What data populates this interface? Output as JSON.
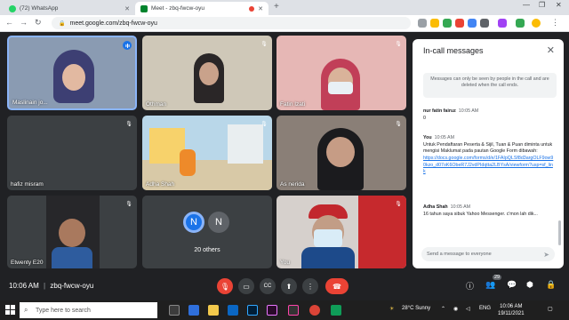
{
  "browser": {
    "tabs": [
      {
        "label": "(72) WhatsApp",
        "color": "#25d366"
      },
      {
        "label": "Meet - zbq-fwcw-oyu",
        "color": "#00832d"
      }
    ],
    "url": "meet.google.com/zbq-fwcw-oyu"
  },
  "tiles": [
    {
      "name": "Maslinain jo...",
      "bg": "#8a9bb2",
      "muted": false
    },
    {
      "name": "Othman",
      "bg": "#cfc8b8",
      "muted": true
    },
    {
      "name": "Fatin Izati",
      "bg": "#e6b7b5",
      "muted": true
    },
    {
      "name": "hafiz misram",
      "bg": "#3c4043",
      "muted": true
    },
    {
      "name": "Adha Shah",
      "bg": "#b9d7e9",
      "muted": true
    },
    {
      "name": "As nerida",
      "bg": "#8a7f77",
      "muted": true
    },
    {
      "name": "Etwenty E20",
      "bg": "#27272a",
      "muted": true
    },
    {
      "name": "20 others",
      "bg": "#3c4043",
      "muted": false
    },
    {
      "name": "You",
      "bg": "#d6d0cc",
      "muted": true
    }
  ],
  "others_avatars": [
    "N",
    "N"
  ],
  "chat": {
    "title": "In-call messages",
    "notice": "Messages can only be seen by people in the call and are deleted when the call ends.",
    "messages": [
      {
        "sender": "nur fatin fairuz",
        "time": "10:05 AM",
        "text": "0",
        "link": ""
      },
      {
        "sender": "You",
        "time": "10:05 AM",
        "text": "Untuk Pendaftaran Peserta & Sijil, Tuan & Puan diminta untuk mengisi Maklumat pada pautan Google Form dibawah:",
        "link": "https://docs.google.com/forms/d/e/1FAIpQLSf8d3argOLF9ow90kzo_d07oK6ObeR7J2vdPIdqtta2LBYsA/viewform?usp=sf_link"
      },
      {
        "sender": "Adha Shah",
        "time": "10:05 AM",
        "text": "16 tahun saya sibuk Yahoo Messenger. c'mon lah dik...",
        "link": ""
      }
    ],
    "input_placeholder": "Send a message to everyone"
  },
  "bottom": {
    "time": "10:06 AM",
    "separator": "|",
    "code": "zbq-fwcw-oyu",
    "participants": "29"
  },
  "taskbar": {
    "search_placeholder": "Type here to search",
    "weather": "28°C  Sunny",
    "lang": "ENG",
    "clock_time": "10:06 AM",
    "clock_date": "19/11/2021"
  },
  "colors": {
    "meet_bg": "#202124",
    "end_call": "#ea4335",
    "link": "#1a73e8"
  }
}
